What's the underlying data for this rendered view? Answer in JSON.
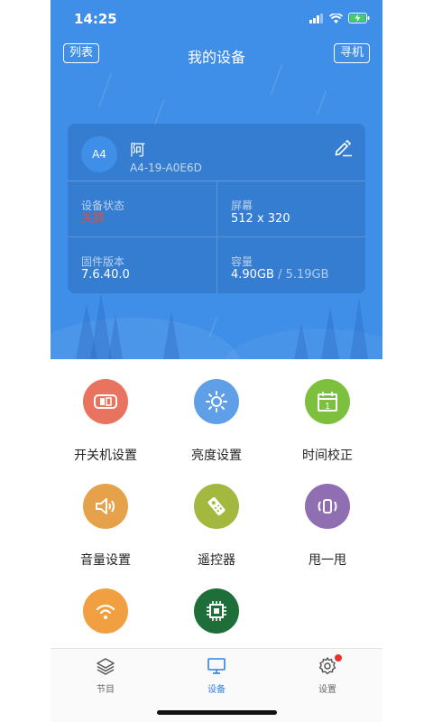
{
  "status_bar": {
    "time": "14:25"
  },
  "nav": {
    "left_button": "列表",
    "title": "我的设备",
    "right_button": "寻机"
  },
  "device": {
    "avatar_text": "A4",
    "name": "阿",
    "id": "A4-19-A0E6D",
    "status_label": "设备状态",
    "status_value": "关屏",
    "screen_label": "屏幕",
    "screen_value": "512 x 320",
    "firmware_label": "固件版本",
    "firmware_value": "7.6.40.0",
    "capacity_label": "容量",
    "capacity_used": "4.90GB",
    "capacity_separator": "/",
    "capacity_total": "5.19GB"
  },
  "functions": [
    {
      "label": "开关机设置",
      "icon": "power-switch-icon",
      "color": "#e8735f"
    },
    {
      "label": "亮度设置",
      "icon": "brightness-icon",
      "color": "#5f9fe8"
    },
    {
      "label": "时间校正",
      "icon": "calendar-icon",
      "color": "#7cc03e"
    },
    {
      "label": "音量设置",
      "icon": "volume-icon",
      "color": "#e5a24a"
    },
    {
      "label": "遥控器",
      "icon": "remote-control-icon",
      "color": "#a2b83e"
    },
    {
      "label": "甩一甩",
      "icon": "shake-icon",
      "color": "#8f6fb2"
    },
    {
      "label": "",
      "icon": "wifi-icon",
      "color": "#f0a040"
    },
    {
      "label": "",
      "icon": "chip-icon",
      "color": "#1e6e3a"
    }
  ],
  "tabs": [
    {
      "label": "节目",
      "icon": "layers-icon",
      "active": false
    },
    {
      "label": "设备",
      "icon": "monitor-icon",
      "active": true
    },
    {
      "label": "设置",
      "icon": "gear-icon",
      "active": false
    }
  ],
  "colors": {
    "header_blue": "#3f8fe8",
    "active_tab": "#2f7fe0",
    "alert_red": "#e84a3c"
  }
}
